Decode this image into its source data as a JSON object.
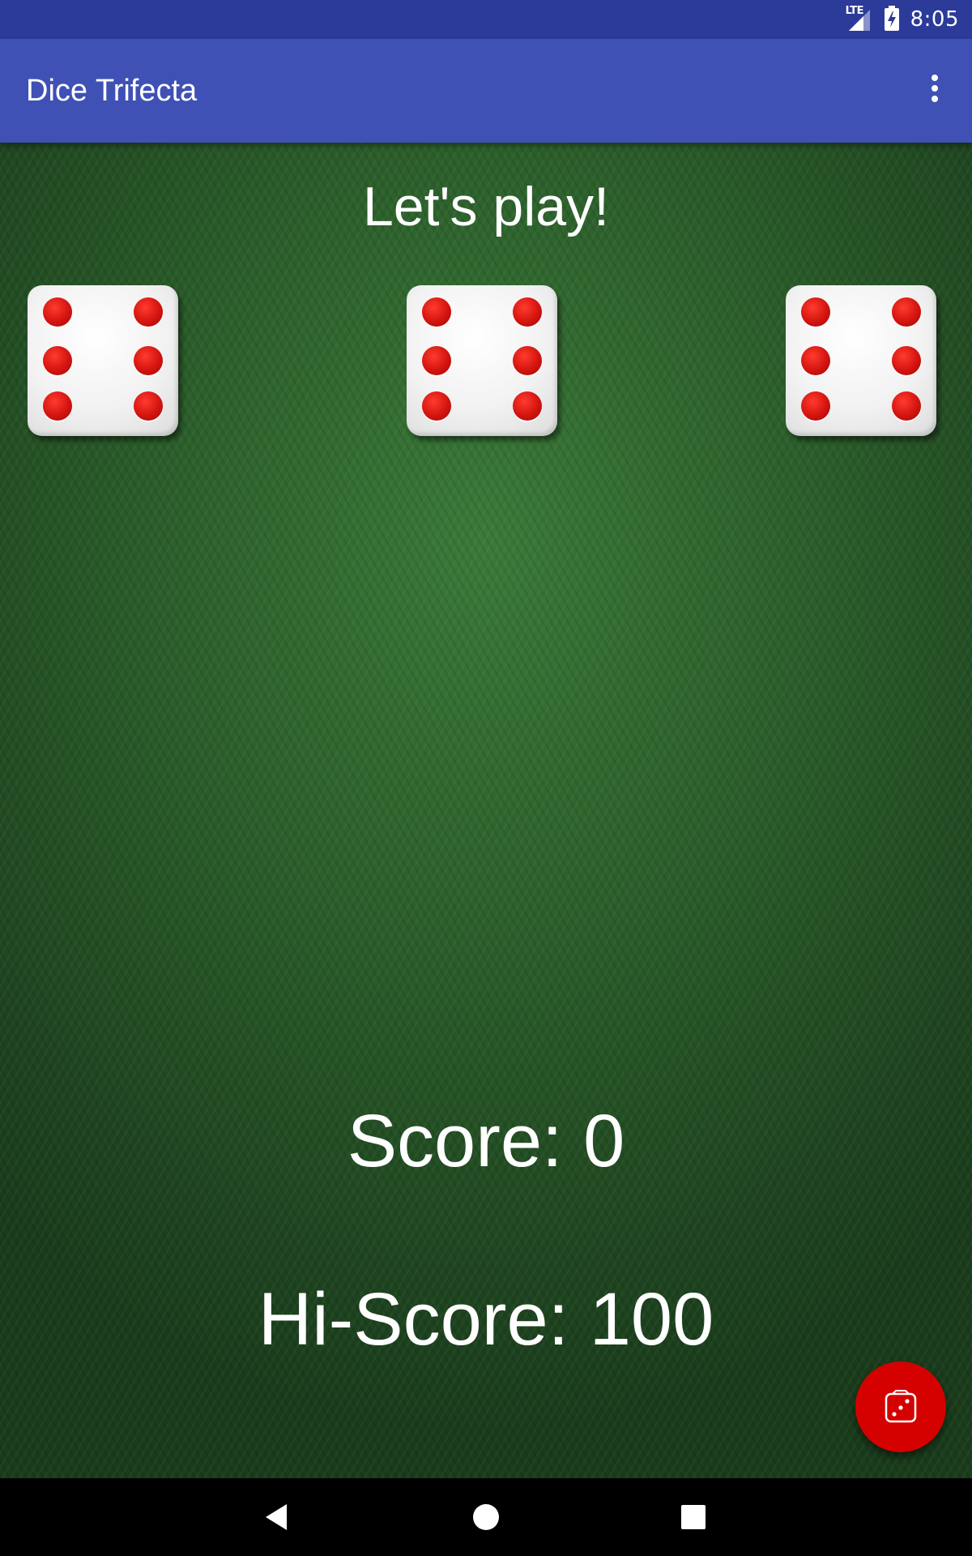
{
  "status_bar": {
    "network_label": "LTE",
    "time": "8:05",
    "icons": [
      "lte-signal-icon",
      "battery-charging-icon"
    ]
  },
  "app_bar": {
    "title": "Dice Trifecta",
    "overflow_icon": "more-vert-icon"
  },
  "game": {
    "prompt": "Let's play!",
    "dice": [
      {
        "value": 6
      },
      {
        "value": 6
      },
      {
        "value": 6
      }
    ],
    "score_text": "Score: 0",
    "hiscore_text": "Hi-Score: 100"
  },
  "fab": {
    "icon": "dice-icon",
    "color": "#d50000"
  },
  "nav_bar": {
    "buttons": [
      "back-icon",
      "home-icon",
      "recents-icon"
    ]
  },
  "colors": {
    "status_bar": "#2c3a9a",
    "app_bar": "#3f51b5",
    "felt": "#2b5e2a",
    "pip": "#d3140f"
  }
}
